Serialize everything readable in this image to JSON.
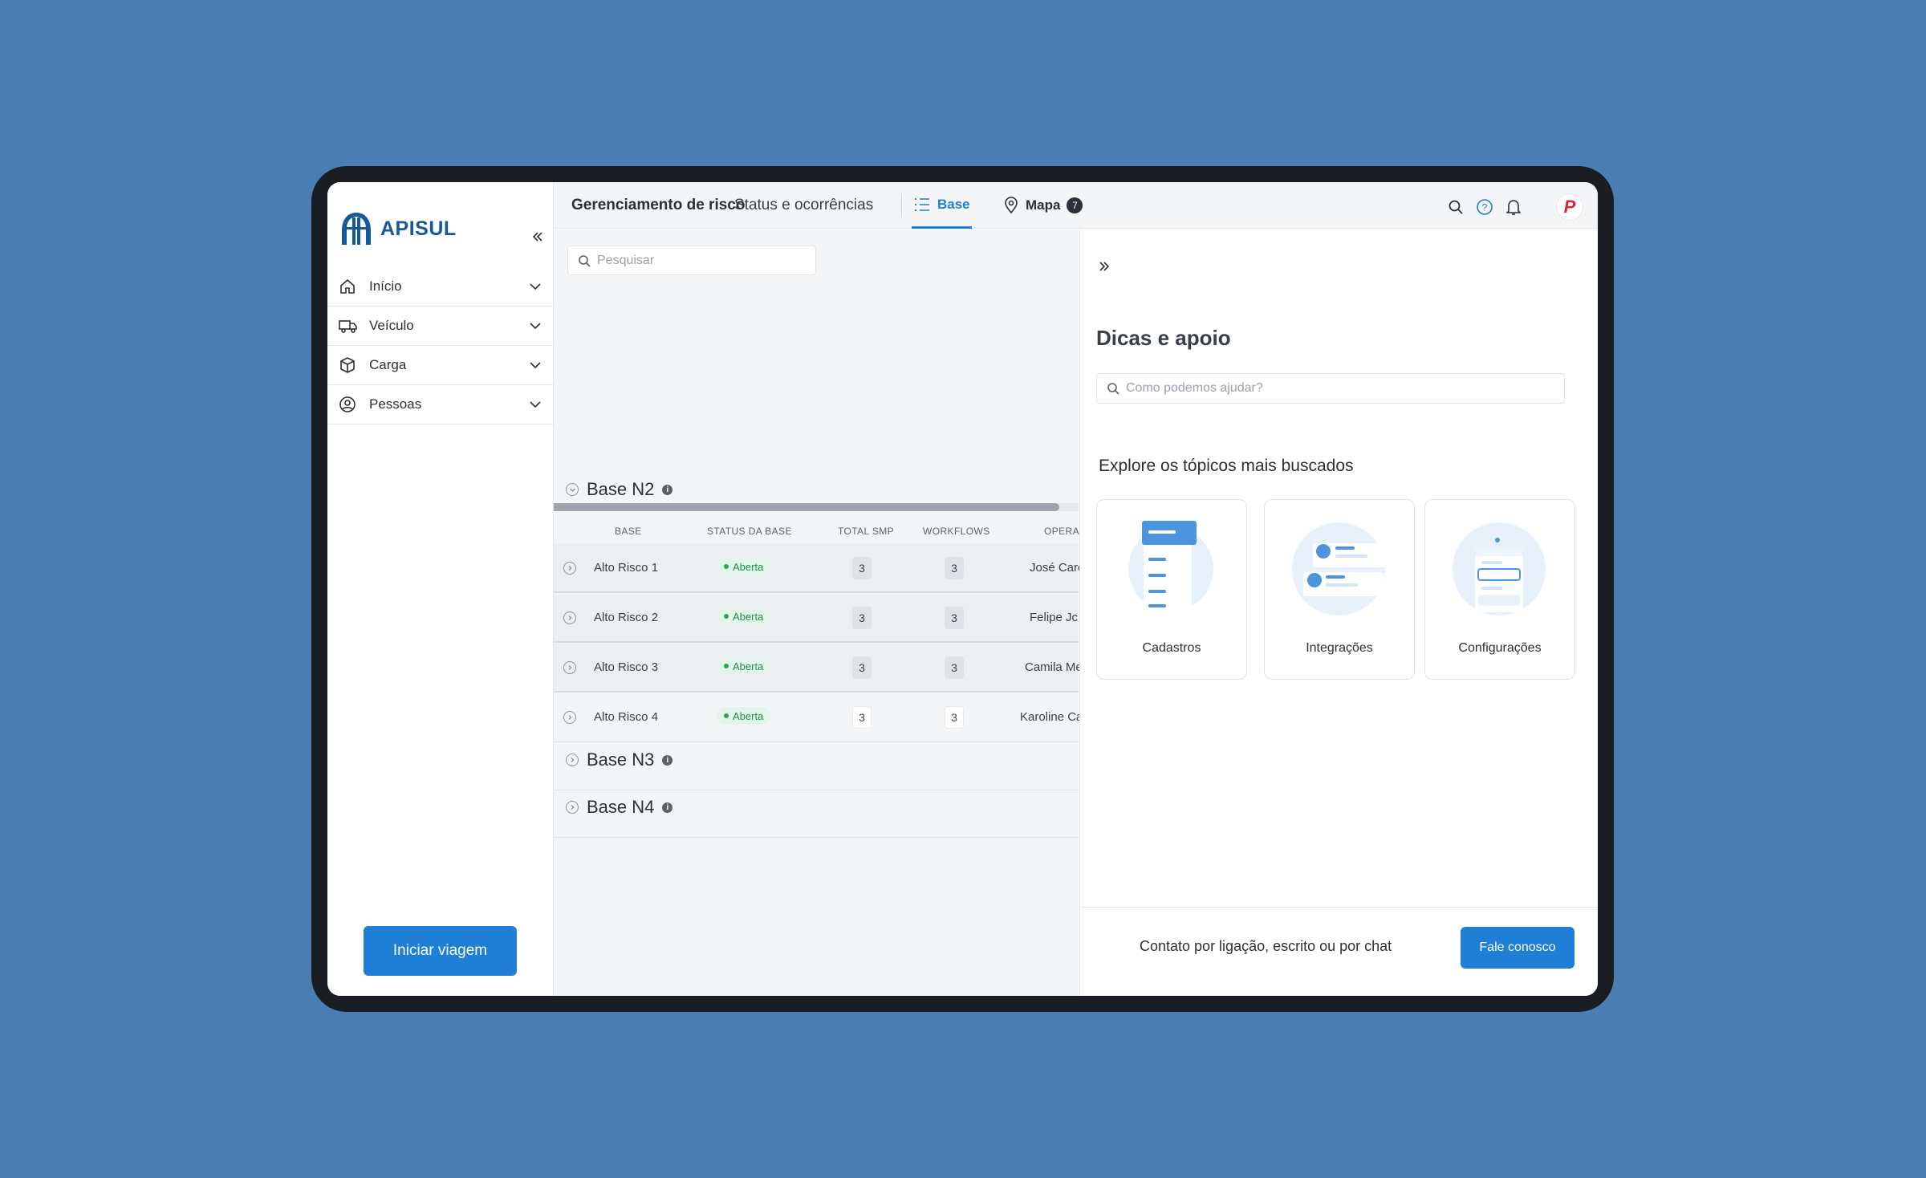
{
  "app": {
    "brand": "APISUL"
  },
  "sidebar": {
    "items": [
      {
        "label": "Início",
        "icon": "home-icon"
      },
      {
        "label": "Veículo",
        "icon": "truck-icon"
      },
      {
        "label": "Carga",
        "icon": "box-icon"
      },
      {
        "label": "Pessoas",
        "icon": "user-circle-icon"
      }
    ],
    "start_button": "Iniciar viagem"
  },
  "topbar": {
    "title": "Gerenciamento de risco",
    "status_tab": "Status e ocorrências",
    "tabs": [
      {
        "label": "Base",
        "active": true
      },
      {
        "label": "Mapa",
        "badge": "7"
      }
    ],
    "avatar_letter": "P"
  },
  "main": {
    "search_placeholder": "Pesquisar",
    "groups": [
      {
        "title": "Base N2",
        "expanded": true
      },
      {
        "title": "Base N3",
        "expanded": false
      },
      {
        "title": "Base N4",
        "expanded": false
      }
    ],
    "columns": [
      "BASE",
      "STATUS DA BASE",
      "TOTAL SMP",
      "WORKFLOWS",
      "OPERAD"
    ],
    "rows": [
      {
        "base": "Alto Risco 1",
        "status": "Aberta",
        "total_smp": "3",
        "workflows": "3",
        "operator": "José Carc"
      },
      {
        "base": "Alto Risco 2",
        "status": "Aberta",
        "total_smp": "3",
        "workflows": "3",
        "operator": "Felipe Jc"
      },
      {
        "base": "Alto Risco 3",
        "status": "Aberta",
        "total_smp": "3",
        "workflows": "3",
        "operator": "Camila Me"
      },
      {
        "base": "Alto Risco 4",
        "status": "Aberta",
        "total_smp": "3",
        "workflows": "3",
        "operator": "Karoline Ca"
      }
    ]
  },
  "panel": {
    "title": "Dicas e apoio",
    "search_placeholder": "Como podemos ajudar?",
    "subtitle": "Explore os tópicos mais buscados",
    "cards": [
      {
        "label": "Cadastros"
      },
      {
        "label": "Integrações"
      },
      {
        "label": "Configurações"
      }
    ],
    "footer_text": "Contato por ligação, escrito ou por chat",
    "footer_button": "Fale conosco"
  },
  "colors": {
    "background": "#4a7db2",
    "accent": "#1f7ed6",
    "brand": "#16599a",
    "status_open": "#27a35a"
  }
}
